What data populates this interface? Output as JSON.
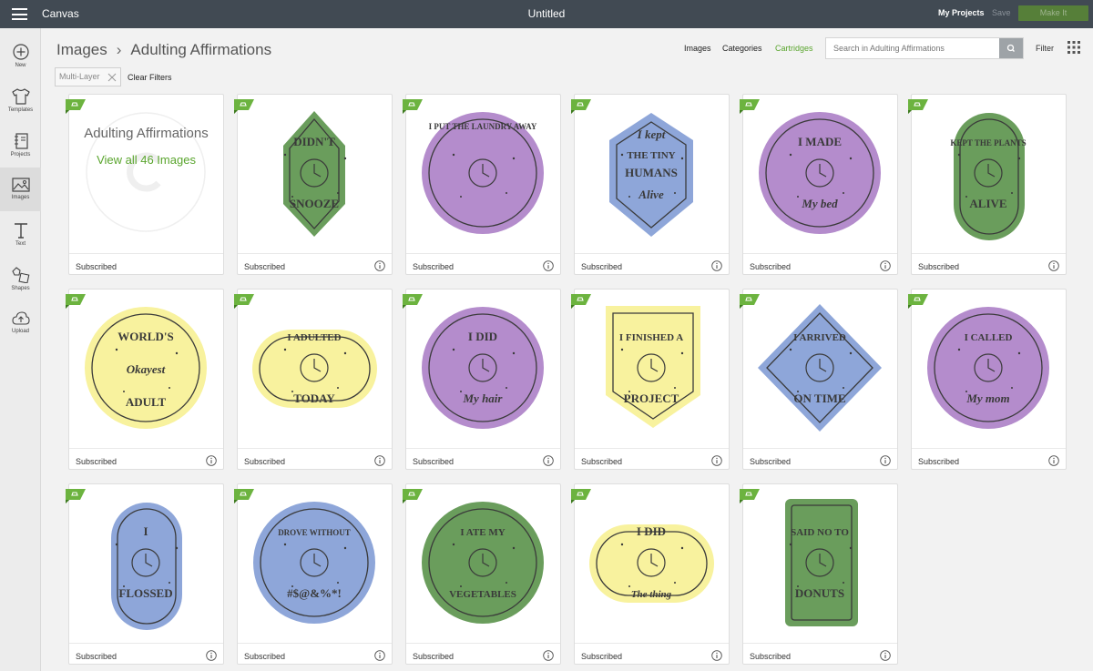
{
  "topbar": {
    "app_title": "Canvas",
    "doc_title": "Untitled",
    "my_projects": "My Projects",
    "save": "Save",
    "make": "Make It"
  },
  "sidebar": {
    "items": [
      {
        "label": "New",
        "icon": "plus-icon"
      },
      {
        "label": "Templates",
        "icon": "tshirt-icon"
      },
      {
        "label": "Projects",
        "icon": "notebook-icon"
      },
      {
        "label": "Images",
        "icon": "image-icon"
      },
      {
        "label": "Text",
        "icon": "text-icon"
      },
      {
        "label": "Shapes",
        "icon": "shapes-icon"
      },
      {
        "label": "Upload",
        "icon": "upload-icon"
      }
    ]
  },
  "breadcrumb": {
    "root": "Images",
    "current": "Adulting Affirmations"
  },
  "header_links": {
    "images": "Images",
    "categories": "Categories",
    "cartridges": "Cartridges"
  },
  "search": {
    "placeholder": "Search in Adulting Affirmations"
  },
  "filter_label": "Filter",
  "chip": {
    "label": "Multi-Layer"
  },
  "clear_filters": "Clear Filters",
  "cover": {
    "title": "Adulting Affirmations",
    "link": "View all 46 Images",
    "footer": "Subscribed"
  },
  "colors": {
    "green": "#6a9d5c",
    "purple": "#b48ccc",
    "blue": "#8ea6d9",
    "yellow": "#f8f29e",
    "accent": "#5aa52e",
    "ink": "#3a3a3a"
  },
  "images": [
    {
      "status": "Subscribed",
      "shape": "hexagon",
      "color": "green",
      "lines": [
        "DIDN'T",
        "SNOOZE"
      ],
      "icon": "alarm-clock-icon"
    },
    {
      "status": "Subscribed",
      "shape": "circle",
      "color": "purple",
      "lines": [
        "I PUT THE LAUNDRY AWAY"
      ],
      "icon": "laundry-basket-icon"
    },
    {
      "status": "Subscribed",
      "shape": "shield",
      "color": "blue",
      "lines": [
        "I kept",
        "THE TINY",
        "HUMANS",
        "Alive"
      ],
      "icon": "banner-icon"
    },
    {
      "status": "Subscribed",
      "shape": "circle",
      "color": "purple",
      "lines": [
        "I MADE",
        "My bed"
      ],
      "icon": "bed-icon"
    },
    {
      "status": "Subscribed",
      "shape": "pill",
      "color": "green",
      "lines": [
        "KEPT THE PLANTS",
        "ALIVE"
      ],
      "icon": "plant-icon"
    },
    {
      "status": "Subscribed",
      "shape": "circle",
      "color": "yellow",
      "lines": [
        "WORLD'S",
        "Okayest",
        "ADULT"
      ],
      "icon": "trophy-icon"
    },
    {
      "status": "Subscribed",
      "shape": "wide-oval",
      "color": "yellow",
      "lines": [
        "I ADULTED",
        "TODAY"
      ],
      "icon": "stars-icon"
    },
    {
      "status": "Subscribed",
      "shape": "circle",
      "color": "purple",
      "lines": [
        "I DID",
        "My hair"
      ],
      "icon": "hair-dryer-icon"
    },
    {
      "status": "Subscribed",
      "shape": "pennant",
      "color": "yellow",
      "lines": [
        "I FINISHED A",
        "PROJECT"
      ],
      "icon": "tools-icon"
    },
    {
      "status": "Subscribed",
      "shape": "diamond",
      "color": "blue",
      "lines": [
        "I ARRIVED",
        "ON TIME"
      ],
      "icon": "watch-icon"
    },
    {
      "status": "Subscribed",
      "shape": "circle",
      "color": "purple",
      "lines": [
        "I CALLED",
        "My mom"
      ],
      "icon": "phone-icon"
    },
    {
      "status": "Subscribed",
      "shape": "pill",
      "color": "blue",
      "lines": [
        "I",
        "FLOSSED"
      ],
      "icon": "tooth-icon"
    },
    {
      "status": "Subscribed",
      "shape": "circle",
      "color": "blue",
      "lines": [
        "DROVE WITHOUT",
        "#$@&%*!"
      ],
      "icon": "car-icon"
    },
    {
      "status": "Subscribed",
      "shape": "circle",
      "color": "green",
      "lines": [
        "I ATE MY",
        "VEGETABLES"
      ],
      "icon": "broccoli-icon"
    },
    {
      "status": "Subscribed",
      "shape": "wide-oval",
      "color": "yellow",
      "lines": [
        "I DID",
        "The thing"
      ],
      "icon": "shooting-star-icon"
    },
    {
      "status": "Subscribed",
      "shape": "rect",
      "color": "green",
      "lines": [
        "SAID NO TO",
        "DONUTS"
      ],
      "icon": "donut-icon"
    }
  ]
}
